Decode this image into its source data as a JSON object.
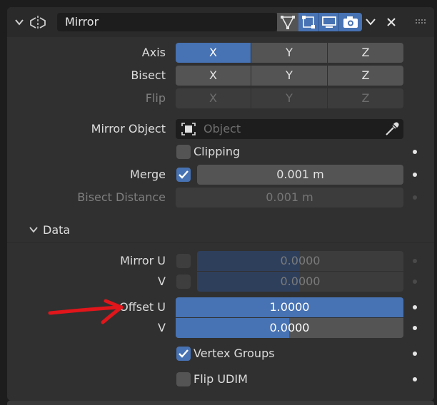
{
  "modifier": {
    "name": "Mirror"
  },
  "axis": {
    "label": "Axis",
    "x": "X",
    "y": "Y",
    "z": "Z"
  },
  "bisect": {
    "label": "Bisect",
    "x": "X",
    "y": "Y",
    "z": "Z"
  },
  "flip": {
    "label": "Flip",
    "x": "X",
    "y": "Y",
    "z": "Z"
  },
  "mirror_object": {
    "label": "Mirror Object",
    "placeholder": "Object"
  },
  "clipping": {
    "label": "Clipping"
  },
  "merge": {
    "label": "Merge",
    "value": "0.001 m"
  },
  "bisect_distance": {
    "label": "Bisect Distance",
    "value": "0.001 m"
  },
  "data_section": {
    "label": "Data"
  },
  "mirror_u": {
    "label": "Mirror U",
    "value": "0.0000"
  },
  "mirror_v": {
    "label": "V",
    "value": "0.0000"
  },
  "offset_u": {
    "label": "Offset U",
    "value": "1.0000"
  },
  "offset_v": {
    "label": "V",
    "value": "0.0000"
  },
  "vertex_groups": {
    "label": "Vertex Groups"
  },
  "flip_udim": {
    "label": "Flip UDIM"
  },
  "colors": {
    "accent": "#4772b3",
    "annotation": "#e0161b"
  }
}
